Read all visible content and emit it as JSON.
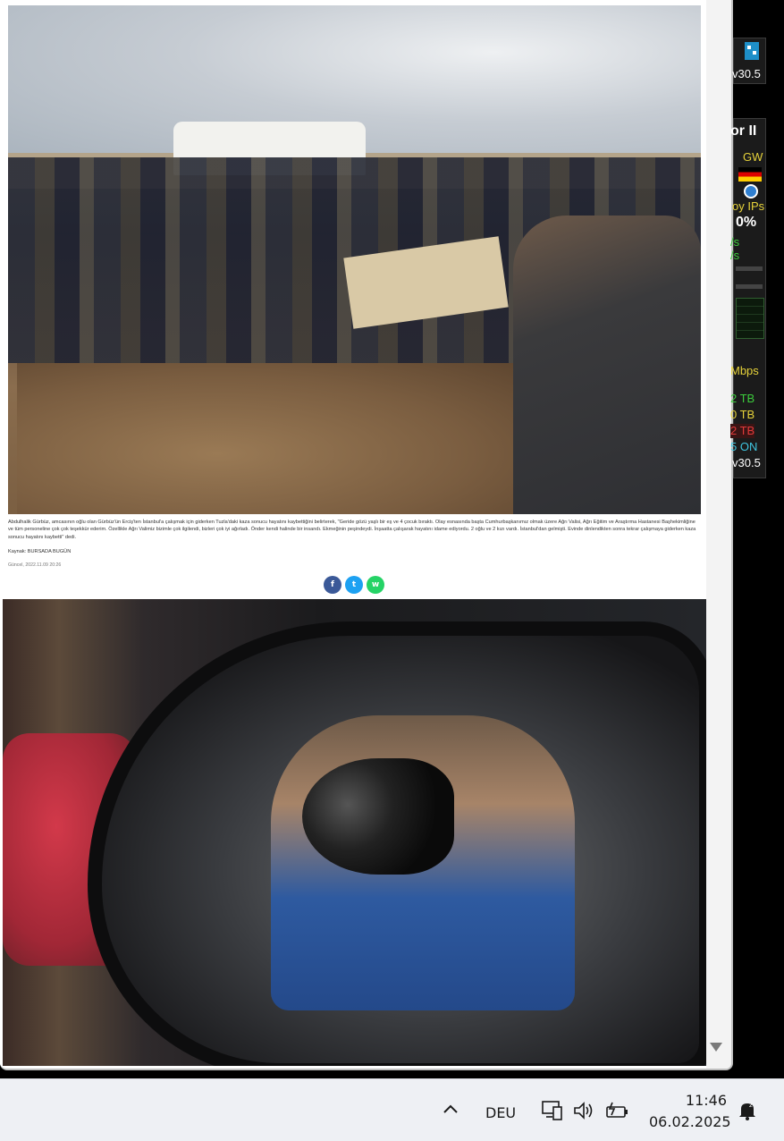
{
  "article": {
    "image1_alt": "",
    "caption": "Abdulhalik Gürbüz, amcasının oğlu olan Gürbüz'ün Erciş'ten İstanbul'a çalışmak için giderken Tuzla'daki kaza sonucu hayatını kaybettiğini belirterek, \"Geride gözü yaşlı bir eş ve 4 çocuk bıraktı. Olay esnasında başta Cumhurbaşkanımız olmak üzere Ağrı Valisi, Ağrı Eğitim ve Araştırma Hastanesi Başhekimliğine ve tüm personeline çok çok teşekkür ederim. Özellikle Ağrı Valimiz bizimle çok ilgilendi, bizleri çok iyi ağırladı. Önder kendi halinde bir insandı. Ekmeğinin peşindeydi. İnşaatta çalışarak hayatını idame ediyordu. 2 oğlu ve 2 kızı vardı. İstanbul'dan gelmişti. Evinde dinlendikten sonra tekrar çalışmaya giderken kaza sonucu hayatını kaybetti\" dedi.",
    "source": "Kaynak: BURSADA BUGÜN",
    "updated": "Güncel, 2022.11.09 20:26",
    "share": {
      "facebook": "f",
      "twitter": "t",
      "whatsapp": "w"
    }
  },
  "monitor": {
    "top_value": "v30.5",
    "label_or": "or II",
    "gw": "GW",
    "ips": "oy IPs",
    "pct": "0%",
    "s1": "/s",
    "s2": "/s",
    "mbps": "Mbps",
    "tb1": "2 TB",
    "tb2": "0 TB",
    "tb3": "2 TB",
    "on": "5 ON",
    "version": "v30.5",
    "colors": {
      "green": "#3ccb3c",
      "yellow": "#e6d23a",
      "red": "#e03a3a",
      "white": "#ffffff",
      "cyan": "#3fc6e0"
    }
  },
  "taskbar": {
    "language": "DEU",
    "time": "11:46",
    "date": "06.02.2025",
    "icons": [
      "chevron-up-icon",
      "network-icon",
      "volume-icon",
      "battery-icon",
      "notification-bell-icon"
    ]
  }
}
